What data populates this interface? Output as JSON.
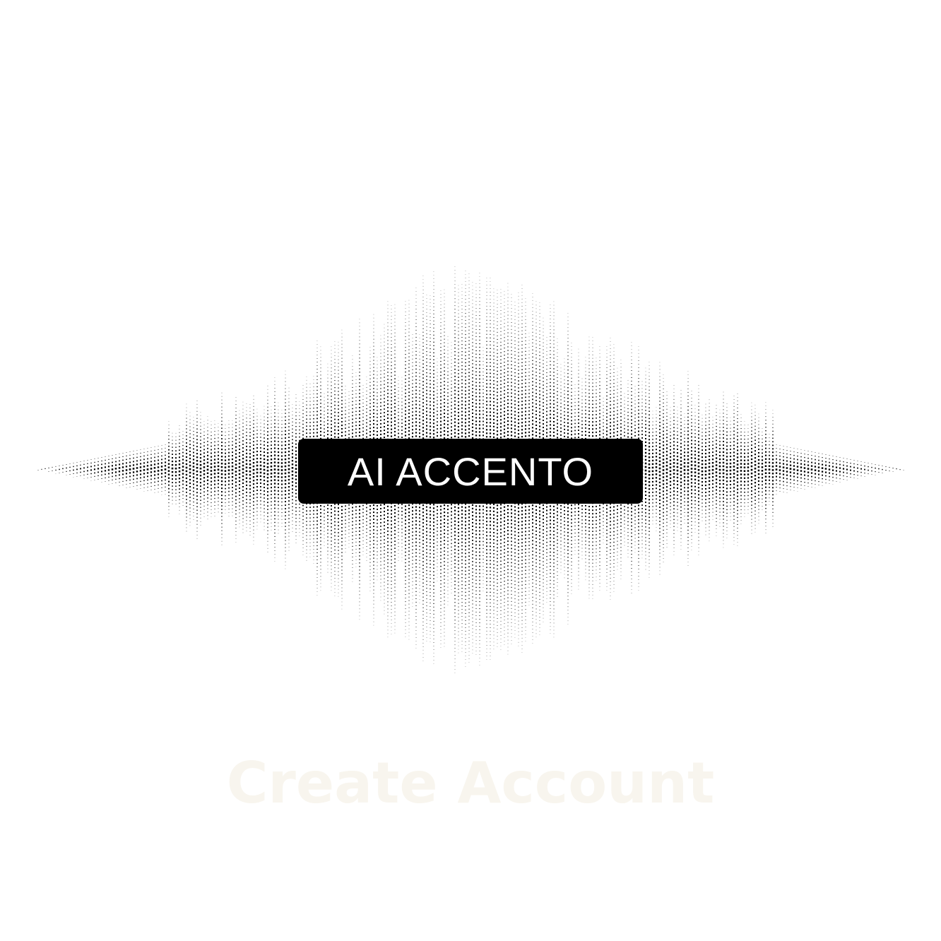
{
  "logo": {
    "brand_text": "AI ACCENTO",
    "wave_icon": "halftone-soundwave-icon",
    "wave_color": "#000000",
    "box_color": "#000000",
    "text_color": "#ffffff"
  },
  "actions": {
    "create_account_label": "Create Account",
    "create_account_color": "#f8f5ee"
  }
}
